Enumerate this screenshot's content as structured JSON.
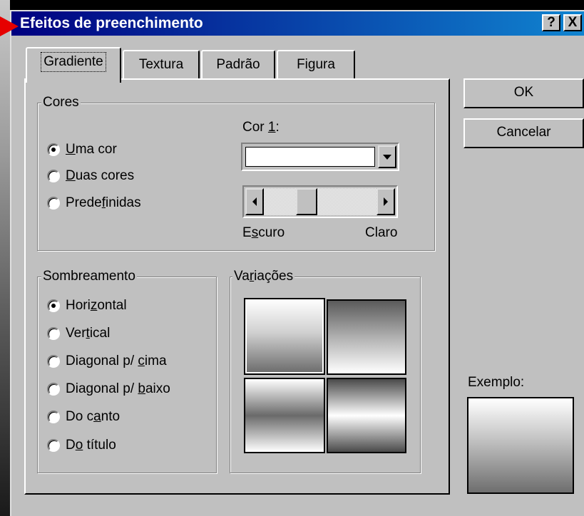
{
  "dialog": {
    "title": "Efeitos de preenchimento",
    "help_label": "?",
    "close_label": "X"
  },
  "tabs": [
    {
      "label": "Gradiente",
      "active": true
    },
    {
      "label": "Textura"
    },
    {
      "label": "Padrão"
    },
    {
      "label": "Figura"
    }
  ],
  "colors_group": {
    "legend": "Cores",
    "options": [
      {
        "pre": "",
        "key": "U",
        "post": "ma cor",
        "checked": true
      },
      {
        "pre": "",
        "key": "D",
        "post": "uas cores",
        "checked": false
      },
      {
        "pre": "Prede",
        "key": "f",
        "post": "inidas",
        "checked": false
      }
    ],
    "color1": {
      "pre": "Cor ",
      "key": "1",
      "post": ":"
    },
    "dark": {
      "pre": "E",
      "key": "s",
      "post": "curo"
    },
    "light": "Claro",
    "slider_value": 0.35
  },
  "shading_group": {
    "legend": "Sombreamento",
    "options": [
      {
        "pre": "Hori",
        "key": "z",
        "post": "ontal",
        "checked": true
      },
      {
        "pre": "Ver",
        "key": "t",
        "post": "ical",
        "checked": false
      },
      {
        "pre": "Diagonal p/ ",
        "key": "c",
        "post": "ima",
        "checked": false
      },
      {
        "pre": "Diagonal p/ ",
        "key": "b",
        "post": "aixo",
        "checked": false
      },
      {
        "pre": "Do c",
        "key": "a",
        "post": "nto",
        "checked": false
      },
      {
        "pre": "D",
        "key": "o",
        "post": " título",
        "checked": false
      }
    ]
  },
  "variants_group": {
    "legend_pre": "Va",
    "legend_key": "r",
    "legend_post": "iações"
  },
  "buttons": {
    "ok": "OK",
    "cancel": "Cancelar"
  },
  "sample_label": "Exemplo:",
  "colors": {
    "face": "#c0c0c0",
    "title_start": "#000080",
    "title_end": "#1084d0",
    "pointer": "#e60000"
  }
}
